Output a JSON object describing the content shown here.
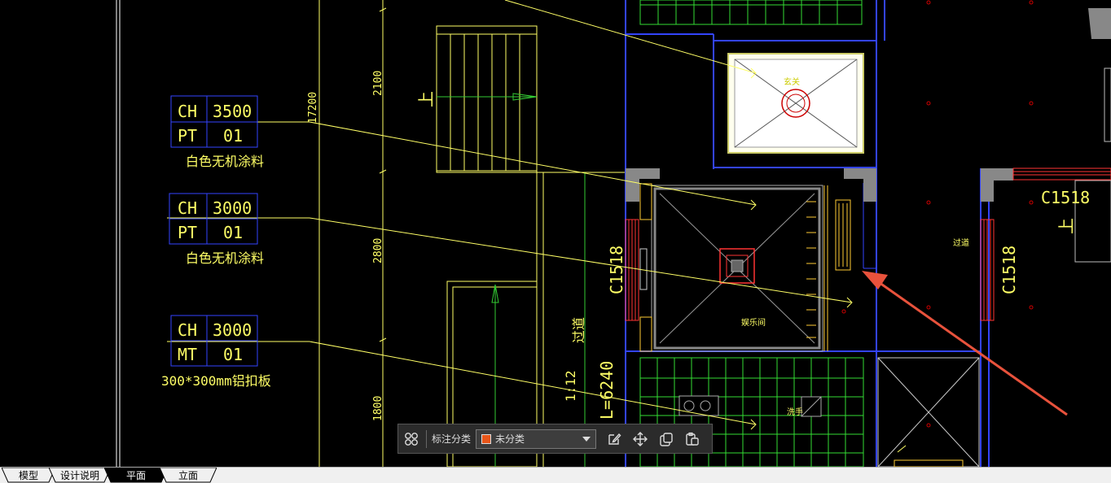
{
  "drawing": {
    "tags": [
      {
        "code": "CH",
        "value": "3500",
        "code2": "PT",
        "value2": "01",
        "material": "白色无机涂料"
      },
      {
        "code": "CH",
        "value": "3000",
        "code2": "PT",
        "value2": "01",
        "material": "白色无机涂料"
      },
      {
        "code": "CH",
        "value": "3000",
        "code2": "MT",
        "value2": "01",
        "material": "300*300mm铝扣板"
      }
    ],
    "dimensions": {
      "d1": "2100",
      "d2": "2800",
      "d3": "1800",
      "total": "17200"
    },
    "labels": {
      "up1": "上",
      "up2": "上",
      "window1": "C1518",
      "window2": "C1518",
      "window3": "C1518",
      "corridor1": "过道",
      "corridor2": "过道",
      "slope": "1:12",
      "length": "L=6240",
      "room1": "玄关",
      "room2": "娱乐间",
      "room3": "洗手"
    }
  },
  "toolbar": {
    "category_label": "标注分类",
    "category_value": "未分类",
    "category_color": "#e8561a"
  },
  "tabs": [
    {
      "label": "模型",
      "active": false
    },
    {
      "label": "设计说明",
      "active": false
    },
    {
      "label": "平面",
      "active": true
    },
    {
      "label": "立面",
      "active": false
    }
  ]
}
